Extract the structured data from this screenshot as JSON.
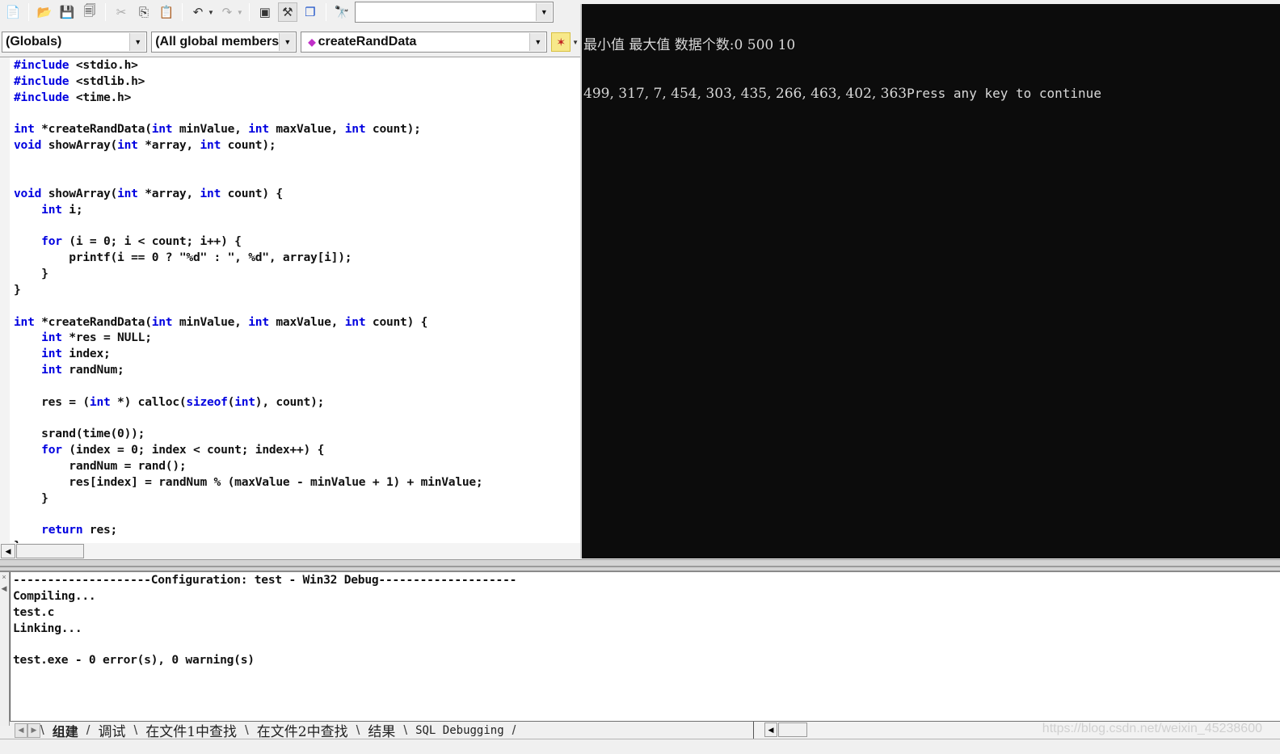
{
  "toolbar": {
    "buttons": [
      {
        "name": "new-text-file",
        "icon": "📄"
      },
      {
        "name": "open",
        "icon": "📂"
      },
      {
        "name": "save",
        "icon": "💾"
      },
      {
        "name": "save-all",
        "icon": "🗐"
      },
      {
        "name": "cut",
        "icon": "✂"
      },
      {
        "name": "copy",
        "icon": "⎘"
      },
      {
        "name": "paste",
        "icon": "📋"
      },
      {
        "name": "undo",
        "icon": "↶"
      },
      {
        "name": "redo",
        "icon": "↷"
      },
      {
        "name": "workspace",
        "icon": "▣"
      },
      {
        "name": "output",
        "icon": "⚒"
      },
      {
        "name": "window-list",
        "icon": "❐"
      },
      {
        "name": "find-in-files",
        "icon": "🔭"
      }
    ],
    "find_combo_value": "",
    "dropdown_arrow": "▼"
  },
  "wizardbar": {
    "class_combo": "(Globals)",
    "filter_combo": "(All global members",
    "member_combo": "createRandData",
    "member_icon": "◆",
    "wizard_icon": "✶"
  },
  "editor": {
    "lines": [
      [
        {
          "k": "kw",
          "t": "#include"
        },
        {
          "t": " <stdio.h>"
        }
      ],
      [
        {
          "k": "kw",
          "t": "#include"
        },
        {
          "t": " <stdlib.h>"
        }
      ],
      [
        {
          "k": "kw",
          "t": "#include"
        },
        {
          "t": " <time.h>"
        }
      ],
      [],
      [
        {
          "k": "kw",
          "t": "int"
        },
        {
          "t": " *createRandData("
        },
        {
          "k": "kw",
          "t": "int"
        },
        {
          "t": " minValue, "
        },
        {
          "k": "kw",
          "t": "int"
        },
        {
          "t": " maxValue, "
        },
        {
          "k": "kw",
          "t": "int"
        },
        {
          "t": " count);"
        }
      ],
      [
        {
          "k": "kw",
          "t": "void"
        },
        {
          "t": " showArray("
        },
        {
          "k": "kw",
          "t": "int"
        },
        {
          "t": " *array, "
        },
        {
          "k": "kw",
          "t": "int"
        },
        {
          "t": " count);"
        }
      ],
      [],
      [],
      [
        {
          "k": "kw",
          "t": "void"
        },
        {
          "t": " showArray("
        },
        {
          "k": "kw",
          "t": "int"
        },
        {
          "t": " *array, "
        },
        {
          "k": "kw",
          "t": "int"
        },
        {
          "t": " count) {"
        }
      ],
      [
        {
          "t": "    "
        },
        {
          "k": "kw",
          "t": "int"
        },
        {
          "t": " i;"
        }
      ],
      [],
      [
        {
          "t": "    "
        },
        {
          "k": "kw",
          "t": "for"
        },
        {
          "t": " (i = 0; i < count; i++) {"
        }
      ],
      [
        {
          "t": "        printf(i == 0 ? \"%d\" : \", %d\", array[i]);"
        }
      ],
      [
        {
          "t": "    }"
        }
      ],
      [
        {
          "t": "}"
        }
      ],
      [],
      [
        {
          "k": "kw",
          "t": "int"
        },
        {
          "t": " *createRandData("
        },
        {
          "k": "kw",
          "t": "int"
        },
        {
          "t": " minValue, "
        },
        {
          "k": "kw",
          "t": "int"
        },
        {
          "t": " maxValue, "
        },
        {
          "k": "kw",
          "t": "int"
        },
        {
          "t": " count) {"
        }
      ],
      [
        {
          "t": "    "
        },
        {
          "k": "kw",
          "t": "int"
        },
        {
          "t": " *res = NULL;"
        }
      ],
      [
        {
          "t": "    "
        },
        {
          "k": "kw",
          "t": "int"
        },
        {
          "t": " index;"
        }
      ],
      [
        {
          "t": "    "
        },
        {
          "k": "kw",
          "t": "int"
        },
        {
          "t": " randNum;"
        }
      ],
      [],
      [
        {
          "t": "    res = ("
        },
        {
          "k": "kw",
          "t": "int"
        },
        {
          "t": " *) calloc("
        },
        {
          "k": "kw",
          "t": "sizeof"
        },
        {
          "t": "("
        },
        {
          "k": "kw",
          "t": "int"
        },
        {
          "t": "), count);"
        }
      ],
      [],
      [
        {
          "t": "    srand(time(0));"
        }
      ],
      [
        {
          "t": "    "
        },
        {
          "k": "kw",
          "t": "for"
        },
        {
          "t": " (index = 0; index < count; index++) {"
        }
      ],
      [
        {
          "t": "        randNum = rand();"
        }
      ],
      [
        {
          "t": "        res[index] = randNum % (maxValue - minValue + 1) + minValue;"
        }
      ],
      [
        {
          "t": "    }"
        }
      ],
      [],
      [
        {
          "t": "    "
        },
        {
          "k": "kw",
          "t": "return"
        },
        {
          "t": " res;"
        }
      ],
      [
        {
          "t": "}"
        }
      ]
    ],
    "keyword_color": "#0000e0"
  },
  "console": {
    "line1": "最小值 最大值 数据个数:0 500 10",
    "line2": "499, 317, 7, 454, 303, 435, 266, 463, 402, 363",
    "line2_tail": "Press any key to continue"
  },
  "output": {
    "lines": [
      "--------------------Configuration: test - Win32 Debug--------------------",
      "Compiling...",
      "test.c",
      "Linking...",
      "",
      "test.exe - 0 error(s), 0 warning(s)"
    ]
  },
  "tabs": [
    {
      "label": "组建",
      "active": true
    },
    {
      "label": "调试",
      "active": false
    },
    {
      "label": "在文件1中查找",
      "active": false
    },
    {
      "label": "在文件2中查找",
      "active": false
    },
    {
      "label": "结果",
      "active": false
    },
    {
      "label": "SQL Debugging",
      "active": false
    }
  ],
  "watermark": "https://blog.csdn.net/weixin_45238600",
  "scroll": {
    "left_arrow": "◀",
    "right_arrow": "▶"
  }
}
